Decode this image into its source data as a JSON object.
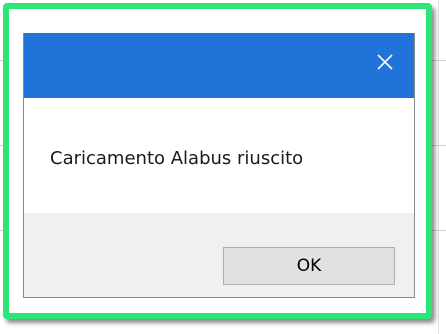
{
  "dialog": {
    "message": "Caricamento Alabus riuscito",
    "ok_label": "OK",
    "close_icon": "close-icon",
    "colors": {
      "titlebar": "#1f73d9",
      "highlight": "#2ee57a",
      "footer": "#f0f0f0",
      "button": "#e1e1e1"
    }
  }
}
